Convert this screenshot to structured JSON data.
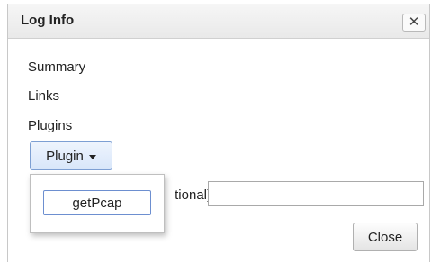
{
  "dialog": {
    "title": "Log Info",
    "close_icon_glyph": "✕",
    "items": [
      {
        "label": "Summary"
      },
      {
        "label": "Links"
      },
      {
        "label": "Plugins"
      }
    ],
    "plugin_button_label": "Plugin",
    "plugin_menu": [
      "getPcap"
    ],
    "comment_label_visible": "tional)",
    "comment_value": "",
    "close_button_label": "Close"
  },
  "colors": {
    "accent_border": "#7d9fd3",
    "accent_fill": "#d8e6fa",
    "titlebar": "#e9e9e9"
  }
}
